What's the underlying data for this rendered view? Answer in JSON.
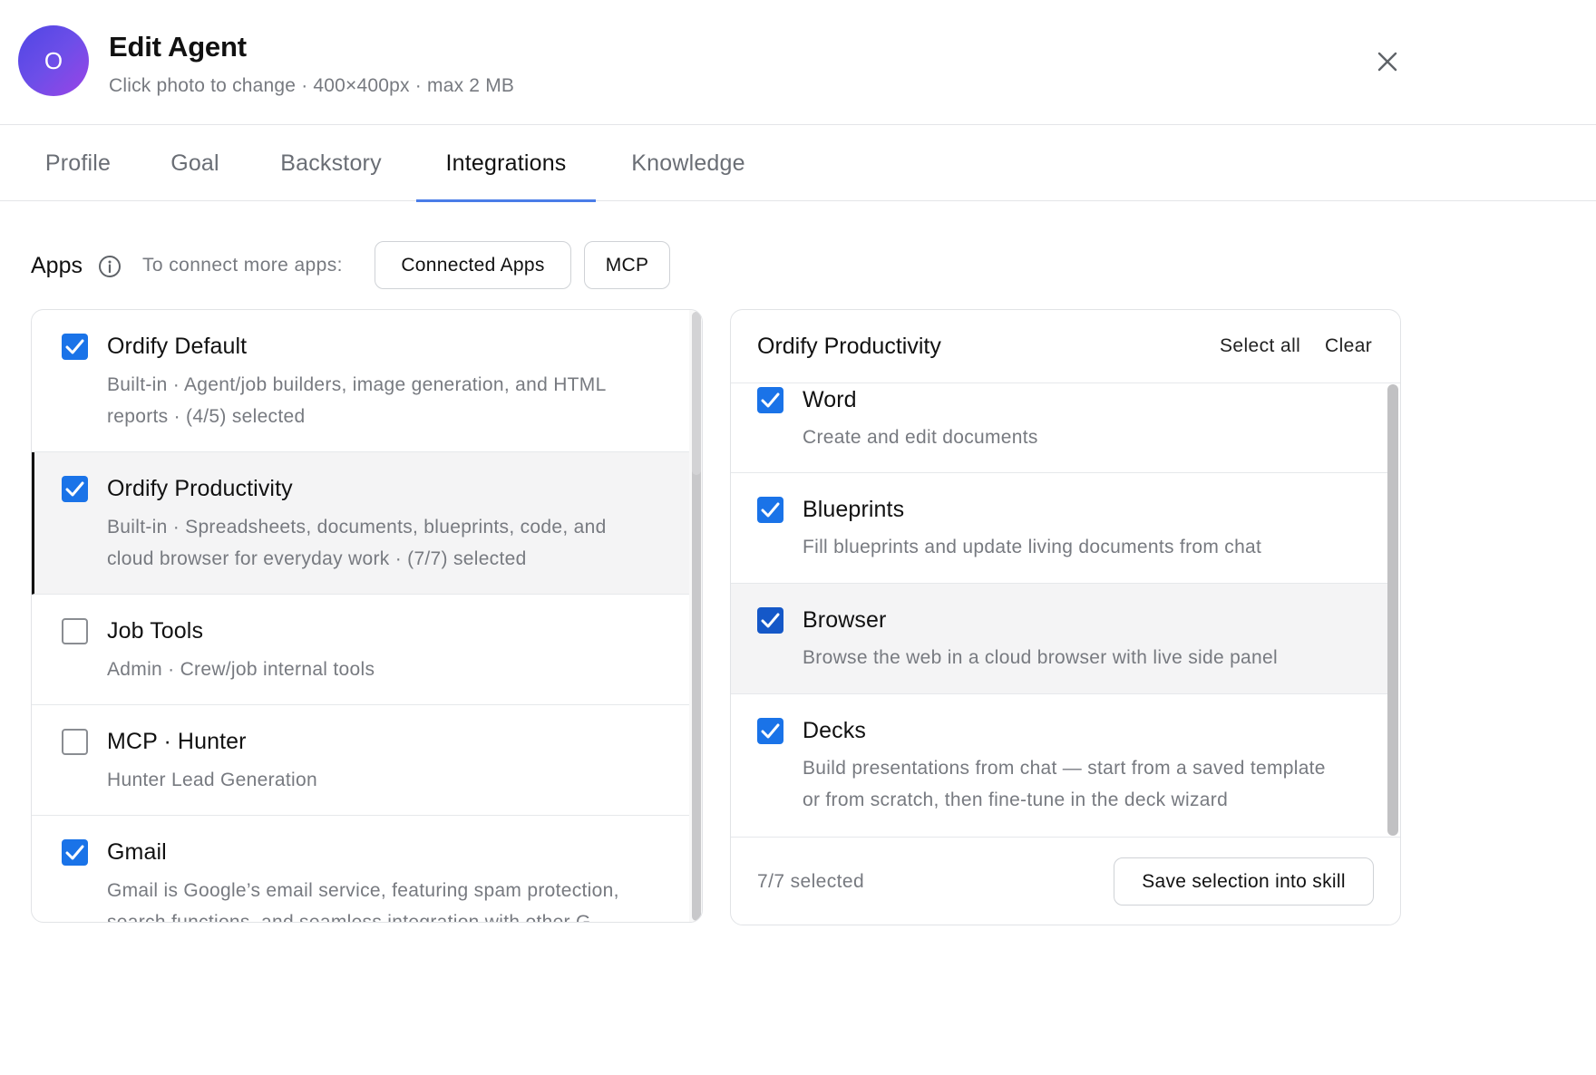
{
  "header": {
    "avatar_initial": "O",
    "title": "Edit Agent",
    "subtitle": "Click photo to change · 400×400px · max 2 MB",
    "close_icon": "close-icon"
  },
  "tabs": [
    {
      "label": "Profile",
      "active": false
    },
    {
      "label": "Goal",
      "active": false
    },
    {
      "label": "Backstory",
      "active": false
    },
    {
      "label": "Integrations",
      "active": true
    },
    {
      "label": "Knowledge",
      "active": false
    }
  ],
  "apps": {
    "label": "Apps",
    "info_icon": "info-icon",
    "hint": "To connect more apps:",
    "connected_apps_button": "Connected Apps",
    "mcp_button": "MCP"
  },
  "app_list": [
    {
      "title": "Ordify Default",
      "desc_line1": "Built-in · Agent/job builders, image generation, and HTML",
      "desc_line2": "reports · (4/5) selected",
      "checked": true
    },
    {
      "title": "Ordify Productivity",
      "desc_line1": "Built-in · Spreadsheets, documents, blueprints, code, and",
      "desc_line2": "cloud browser for everyday work · (7/7) selected",
      "checked": true,
      "selected": true
    },
    {
      "title": "Job Tools",
      "desc_line1": "Admin · Crew/job internal tools",
      "checked": false
    },
    {
      "title": "MCP · Hunter",
      "desc_line1": "Hunter Lead Generation",
      "checked": false
    },
    {
      "title": "Gmail",
      "desc_line1": "Gmail is Google’s email service, featuring spam protection,",
      "desc_line2": "search functions, and seamless integration with other G",
      "checked": true
    }
  ],
  "detail": {
    "title": "Ordify Productivity",
    "select_all": "Select all",
    "clear": "Clear",
    "tools": [
      {
        "title": "Word",
        "desc_line1": "Create and edit documents",
        "checked": true
      },
      {
        "title": "Blueprints",
        "desc_line1": "Fill blueprints and update living documents from chat",
        "checked": true
      },
      {
        "title": "Browser",
        "desc_line1": "Browse the web in a cloud browser with live side panel",
        "checked": true
      },
      {
        "title": "Decks",
        "desc_line1": "Build presentations from chat — start from a saved template",
        "desc_line2": "or from scratch, then fine-tune in the deck wizard",
        "checked": true
      }
    ],
    "selected_count": "7/7 selected",
    "save_button": "Save selection into skill"
  },
  "colors": {
    "accent": "#1a73e8",
    "tab_underline": "#4a7de8",
    "avatar_start": "#4f46e5",
    "avatar_end": "#9a44e6"
  }
}
